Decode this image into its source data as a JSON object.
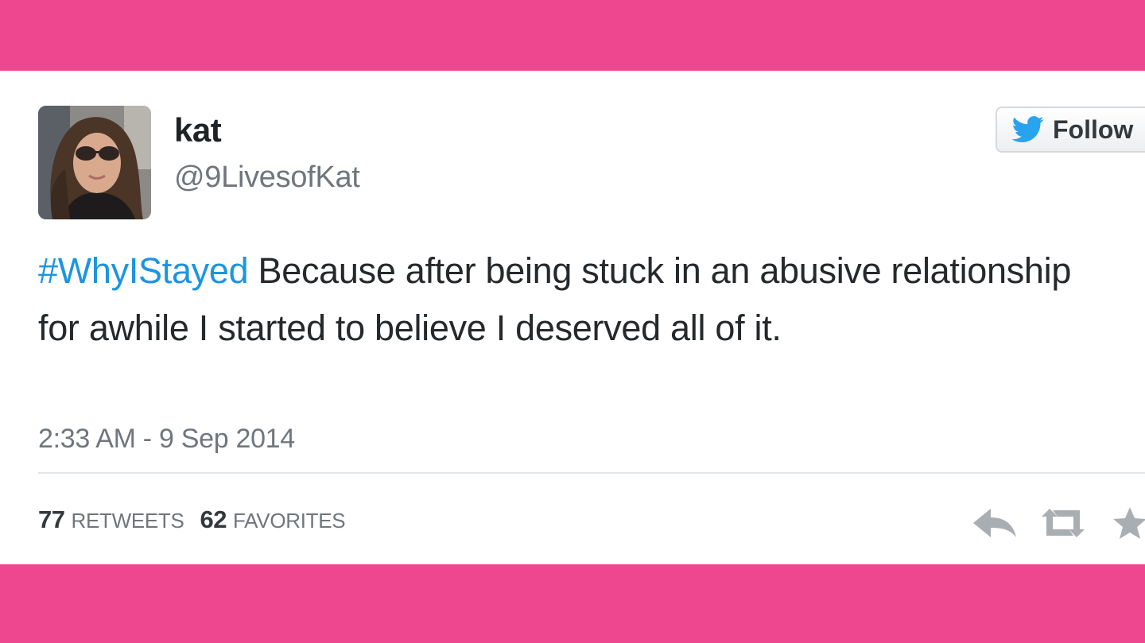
{
  "tweet": {
    "display_name": "kat",
    "handle": "@9LivesofKat",
    "hashtag": "#WhyIStayed",
    "text": " Because after being stuck in an abusive relationship for awhile I started to believe I deserved all of it.",
    "timestamp": "2:33 AM - 9 Sep 2014"
  },
  "follow_button": {
    "label": "Follow",
    "icon": "twitter-bird-icon"
  },
  "stats": {
    "retweets_count": "77",
    "retweets_label": "RETWEETS",
    "favorites_count": "62",
    "favorites_label": "FAVORITES"
  },
  "actions": [
    {
      "icon": "reply-icon"
    },
    {
      "icon": "retweet-icon"
    },
    {
      "icon": "favorite-icon"
    }
  ],
  "colors": {
    "frame": "#ee4790",
    "card": "#ffffff",
    "hashtag": "#1b95e0",
    "bird": "#2aa3ef",
    "muted": "#6f767c",
    "text": "#25292c"
  }
}
